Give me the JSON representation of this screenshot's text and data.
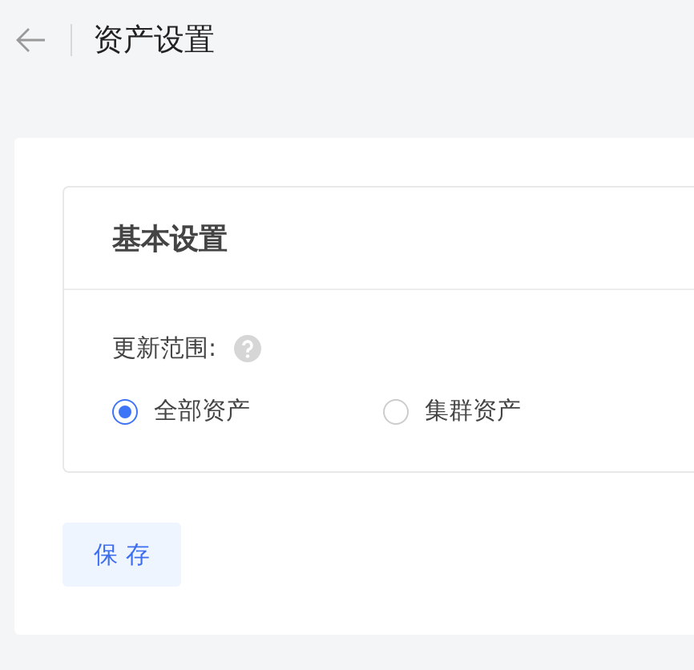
{
  "header": {
    "title": "资产设置"
  },
  "card": {
    "title": "基本设置",
    "field_label": "更新范围:",
    "options": [
      {
        "label": "全部资产",
        "selected": true
      },
      {
        "label": "集群资产",
        "selected": false
      }
    ]
  },
  "buttons": [
    {
      "label": "保 存"
    }
  ]
}
